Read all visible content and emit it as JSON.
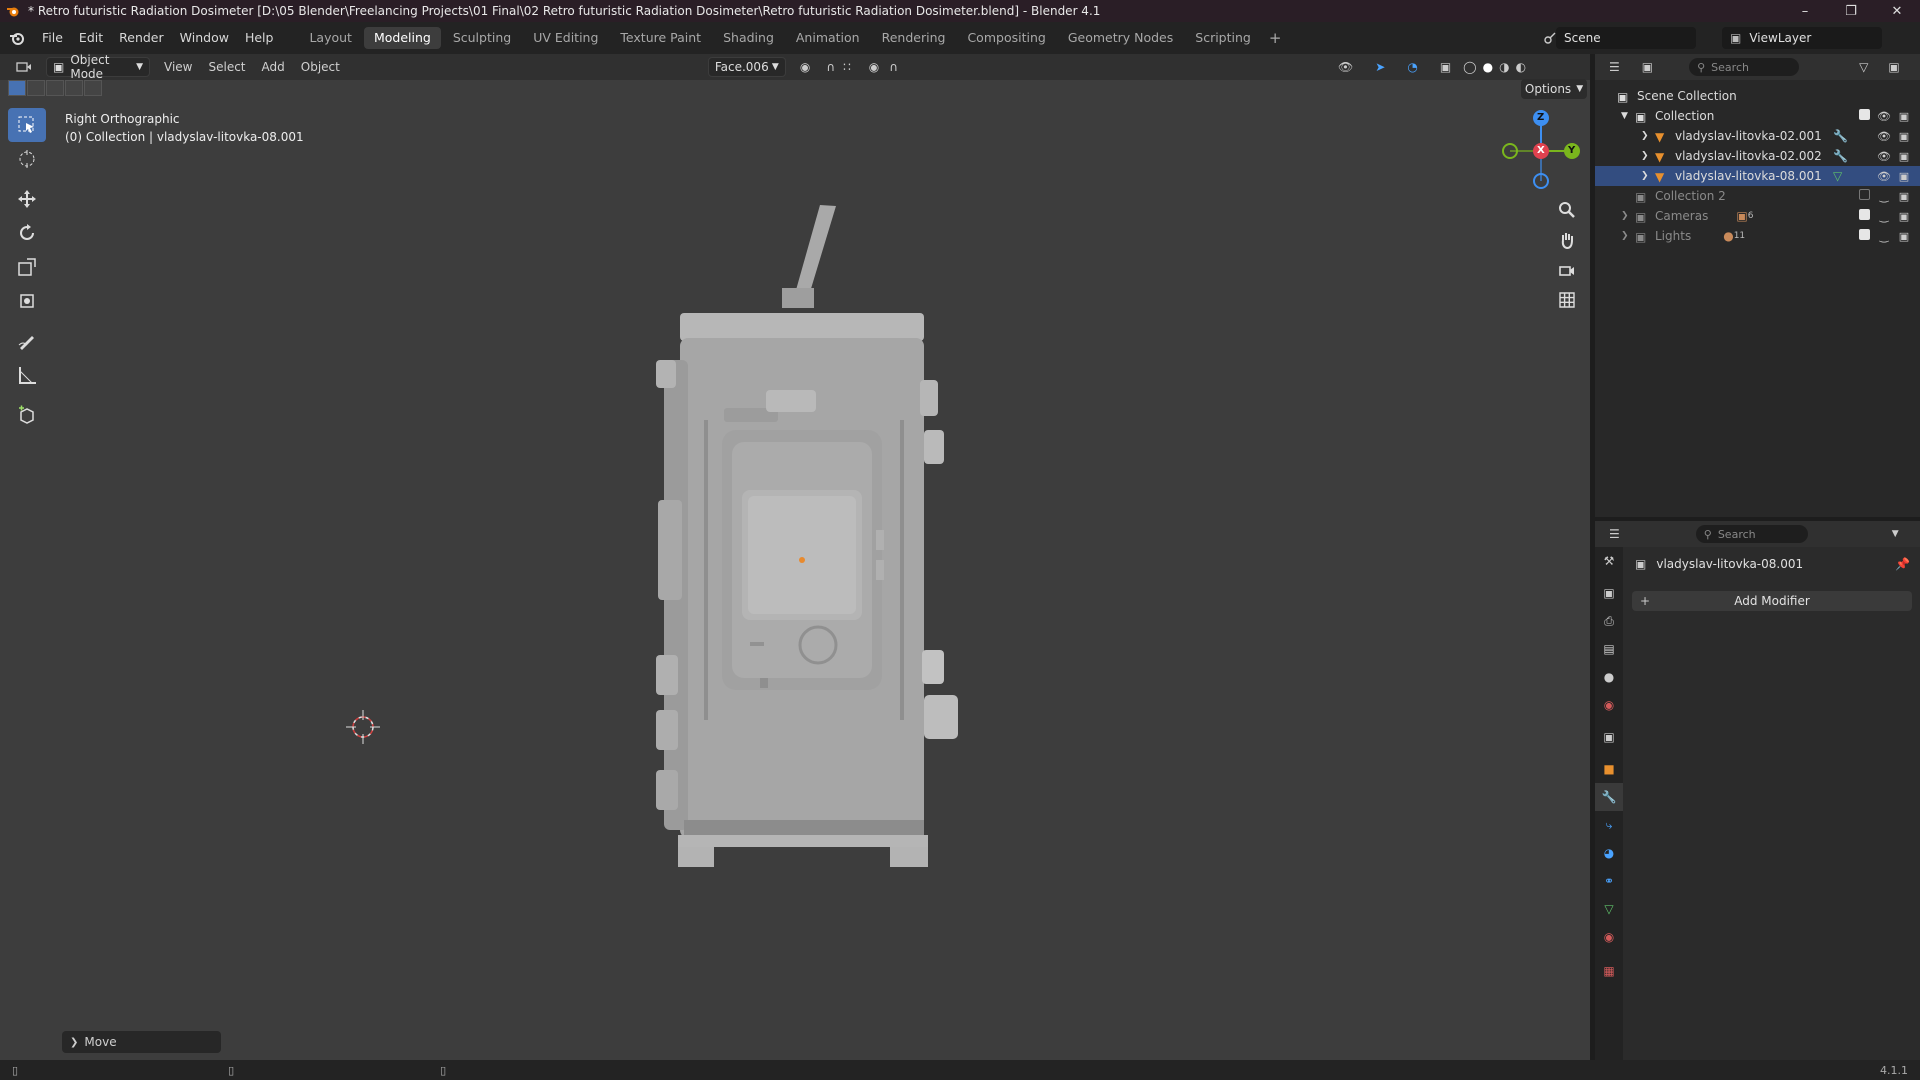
{
  "window": {
    "title": "* Retro futuristic Radiation Dosimeter [D:\\05 Blender\\Freelancing Projects\\01 Final\\02 Retro futuristic Radiation Dosimeter\\Retro futuristic Radiation Dosimeter.blend] - Blender 4.1",
    "minimize": "–",
    "maximize": "❐",
    "close": "✕"
  },
  "menu": [
    "File",
    "Edit",
    "Render",
    "Window",
    "Help"
  ],
  "workspaces": [
    "Layout",
    "Modeling",
    "Sculpting",
    "UV Editing",
    "Texture Paint",
    "Shading",
    "Animation",
    "Rendering",
    "Compositing",
    "Geometry Nodes",
    "Scripting"
  ],
  "active_workspace": "Modeling",
  "scene": "Scene",
  "view_layer": "ViewLayer",
  "viewport_header": {
    "mode": "Object Mode",
    "menus": [
      "View",
      "Select",
      "Add",
      "Object"
    ],
    "active_object_field": "Face.006",
    "options": "Options"
  },
  "viewport": {
    "view_name": "Right Orthographic",
    "collection_info": "(0) Collection | vladyslav-litovka-08.001",
    "last_operator": "Move",
    "gizmo_labels": {
      "z": "Z",
      "x": "X",
      "y": "Y"
    }
  },
  "outliner": {
    "search_placeholder": "Search",
    "rows": [
      {
        "label": "Scene Collection"
      },
      {
        "label": "Collection"
      },
      {
        "label": "vladyslav-litovka-02.001"
      },
      {
        "label": "vladyslav-litovka-02.002"
      },
      {
        "label": "vladyslav-litovka-08.001"
      },
      {
        "label": "Collection 2"
      },
      {
        "label": "Cameras",
        "count": "6"
      },
      {
        "label": "Lights",
        "count": "11"
      }
    ]
  },
  "properties": {
    "search_placeholder": "Search",
    "object_name": "vladyslav-litovka-08.001",
    "add_modifier": "Add Modifier"
  },
  "status": {
    "version": "4.1.1"
  },
  "colors": {
    "accent": "#4772b3",
    "axis_x": "#e0424f",
    "axis_y": "#7ab61d",
    "axis_z": "#3d8ff2"
  }
}
